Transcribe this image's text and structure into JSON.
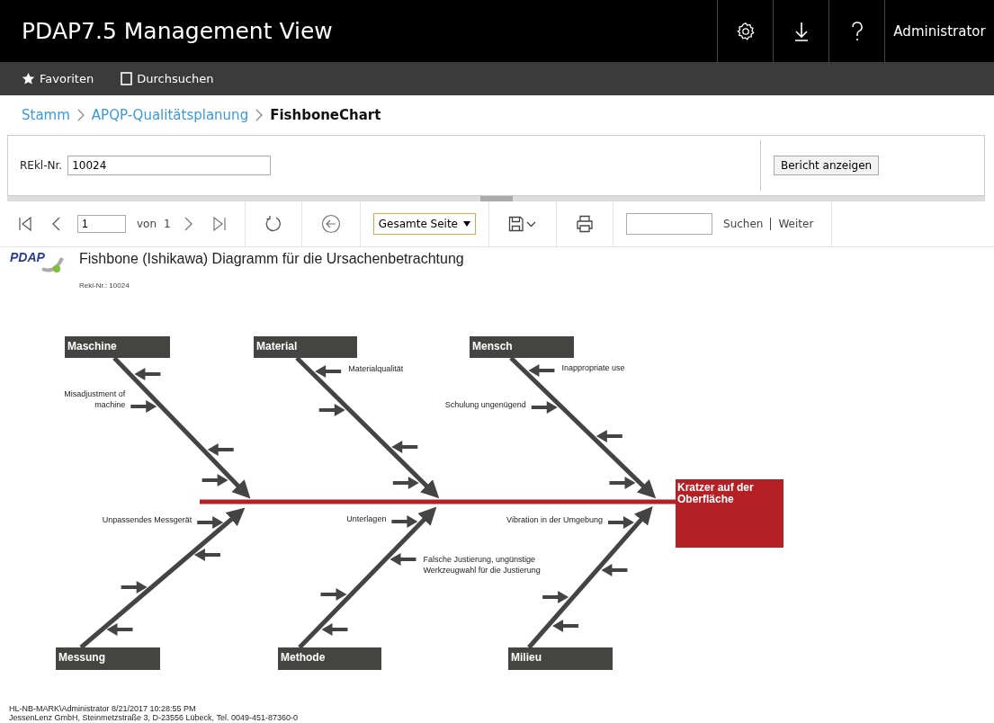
{
  "header": {
    "title": "PDAP7.5 Management View",
    "user": "Administrator"
  },
  "nav": [
    {
      "label": "Favoriten",
      "kind": "star"
    },
    {
      "label": "Durchsuchen",
      "kind": "page"
    }
  ],
  "breadcrumb": [
    {
      "label": "Stamm",
      "current": false
    },
    {
      "label": "APQP-Qualitätsplanung",
      "current": false
    },
    {
      "label": "FishboneChart",
      "current": true
    }
  ],
  "parameters": {
    "label": "REkl-Nr.",
    "value": "10024",
    "button": "Bericht anzeigen"
  },
  "toolbar": {
    "page": "1",
    "of_label": "von",
    "page_count": "1",
    "zoom": "Gesamte Seite",
    "find": "Suchen",
    "next": "Weiter"
  },
  "report": {
    "logo_text": "PDAP",
    "title": "Fishbone (Ishikawa) Diagramm für die Ursachenbetrachtung",
    "subtitle": "Rekl-Nr.: 10024",
    "effect": "Kratzer auf der Oberfläche",
    "categories": [
      {
        "label": "Maschine",
        "causes": [
          {
            "kind": "from_right"
          },
          {
            "kind": "from_left",
            "label": "Misadjustment of machine"
          },
          {
            "kind": "from_right"
          },
          {
            "kind": "from_left"
          }
        ]
      },
      {
        "label": "Material",
        "causes": [
          {
            "kind": "from_right",
            "label": "Materialqualität"
          },
          {
            "kind": "from_left"
          },
          {
            "kind": "from_right"
          },
          {
            "kind": "from_left"
          }
        ]
      },
      {
        "label": "Mensch",
        "causes": [
          {
            "kind": "from_right",
            "label": "Inappropriate use"
          },
          {
            "kind": "from_left",
            "label": "Schulung ungenügend"
          },
          {
            "kind": "from_right"
          },
          {
            "kind": "from_left"
          }
        ]
      },
      {
        "label": "Messung",
        "causes": [
          {
            "kind": "from_left",
            "label": "Unpassendes Messgerät"
          },
          {
            "kind": "from_right"
          },
          {
            "kind": "from_left"
          },
          {
            "kind": "from_right"
          }
        ]
      },
      {
        "label": "Methode",
        "causes": [
          {
            "kind": "from_left",
            "label": "Unterlagen"
          },
          {
            "kind": "from_right",
            "label": "Falsche Justierung, ungünstige Werkzeugwahl für die Justierung"
          },
          {
            "kind": "from_left"
          },
          {
            "kind": "from_right"
          }
        ]
      },
      {
        "label": "Milieu",
        "causes": [
          {
            "kind": "from_left",
            "label": "Vibration in der Umgebung"
          },
          {
            "kind": "from_right"
          },
          {
            "kind": "from_left"
          },
          {
            "kind": "from_right"
          }
        ]
      }
    ],
    "footer": [
      "HL-NB-MARK\\Administrator 8/21/2017 10:28:55 PM",
      "JessenLenz GmbH, Steinmetzstraße 3, D-23556 Lübeck, Tel. 0049-451-87360-0"
    ]
  }
}
